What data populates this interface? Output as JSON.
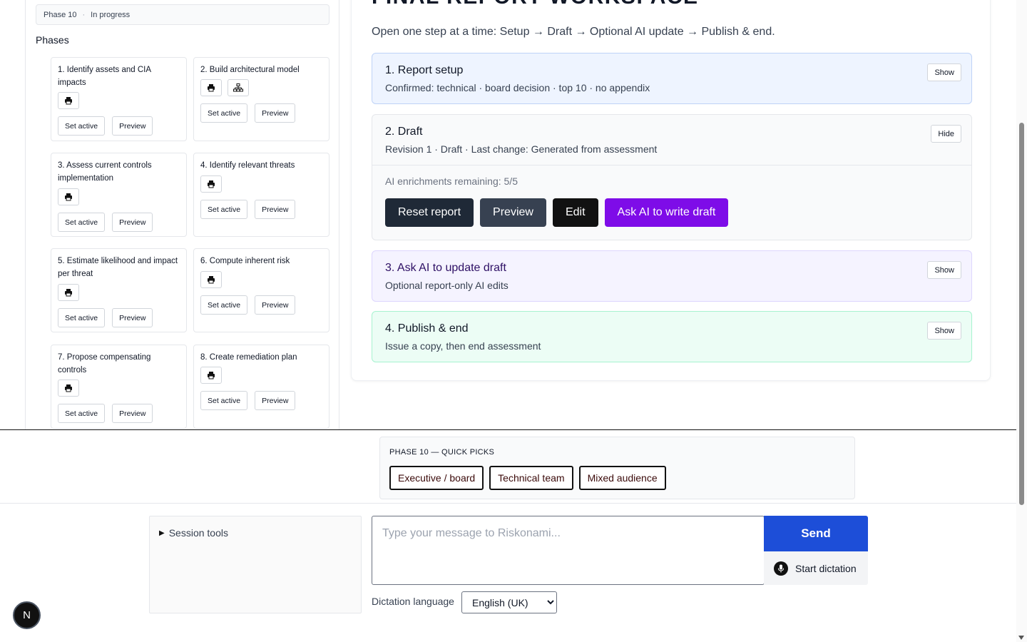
{
  "phase_status": {
    "phase": "Phase 10",
    "separator": "·",
    "status": "In progress"
  },
  "phases_heading": "Phases",
  "phase_cards": [
    {
      "title": "1. Identify assets and CIA impacts",
      "icons": [
        "printer-icon"
      ],
      "set_active": "Set active",
      "preview": "Preview"
    },
    {
      "title": "2. Build architectural model",
      "icons": [
        "printer-icon",
        "diagram-icon"
      ],
      "set_active": "Set active",
      "preview": "Preview"
    },
    {
      "title": "3. Assess current controls implementation",
      "icons": [
        "printer-icon"
      ],
      "set_active": "Set active",
      "preview": "Preview"
    },
    {
      "title": "4. Identify relevant threats",
      "icons": [
        "printer-icon"
      ],
      "set_active": "Set active",
      "preview": "Preview"
    },
    {
      "title": "5. Estimate likelihood and impact per threat",
      "icons": [
        "printer-icon"
      ],
      "set_active": "Set active",
      "preview": "Preview"
    },
    {
      "title": "6. Compute inherent risk",
      "icons": [
        "printer-icon"
      ],
      "set_active": "Set active",
      "preview": "Preview"
    },
    {
      "title": "7. Propose compensating controls",
      "icons": [
        "printer-icon"
      ],
      "set_active": "Set active",
      "preview": "Preview"
    },
    {
      "title": "8. Create remediation plan",
      "icons": [
        "printer-icon"
      ],
      "set_active": "Set active",
      "preview": "Preview"
    }
  ],
  "workspace": {
    "title": "FINAL REPORT WORKSPACE",
    "intro": "Open one step at a time: Setup → Draft → Optional AI update → Publish & end.",
    "steps": {
      "setup": {
        "title": "1. Report setup",
        "subtitle": "Confirmed: technical · board decision · top 10 · no appendix",
        "toggle": "Show"
      },
      "draft": {
        "title": "2. Draft",
        "subtitle": "Revision 1 · Draft · Last change: Generated from assessment",
        "toggle": "Hide",
        "enrichments": "AI enrichments remaining: 5/5",
        "reset": "Reset report",
        "preview": "Preview",
        "edit": "Edit",
        "ask_ai": "Ask AI to write draft"
      },
      "update": {
        "title": "3. Ask AI to update draft",
        "subtitle": "Optional report-only AI edits",
        "toggle": "Show"
      },
      "publish": {
        "title": "4. Publish & end",
        "subtitle": "Issue a copy, then end assessment",
        "toggle": "Show"
      }
    }
  },
  "quick_picks": {
    "label": "PHASE 10 — QUICK PICKS",
    "options": [
      "Executive / board",
      "Technical team",
      "Mixed audience"
    ]
  },
  "session_tools": {
    "label": "Session tools"
  },
  "composer": {
    "placeholder": "Type your message to Riskonami...",
    "send": "Send",
    "dictation": "Start dictation",
    "dictation_language_label": "Dictation language",
    "language_selected": "English (UK)"
  },
  "badge": "N",
  "colors": {
    "accent_purple": "#7e0ce8",
    "send_blue": "#1d4ed8",
    "setup_bg": "#eef4ff",
    "update_bg": "#f5f3ff",
    "publish_bg": "#ecfdf5"
  }
}
